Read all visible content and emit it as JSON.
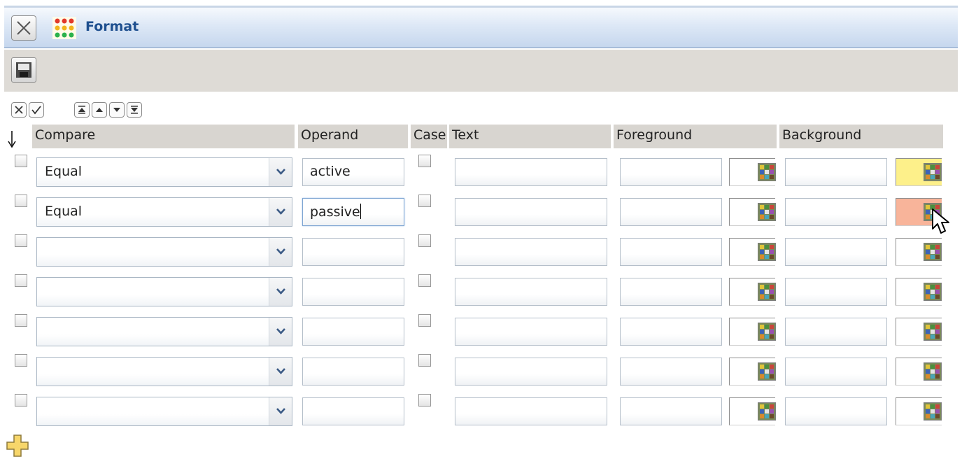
{
  "window": {
    "title": "Format"
  },
  "headers": {
    "compare": "Compare",
    "operand": "Operand",
    "case": "Case",
    "text": "Text",
    "foreground": "Foreground",
    "background": "Background"
  },
  "colors": {
    "row1_background_swatch": "#fdf08a",
    "row2_background_swatch": "#f8b49a",
    "title_text": "#1e4f8f"
  },
  "rows": [
    {
      "compare": "Equal",
      "operand": "active"
    },
    {
      "compare": "Equal",
      "operand": "passive"
    },
    {
      "compare": "",
      "operand": ""
    },
    {
      "compare": "",
      "operand": ""
    },
    {
      "compare": "",
      "operand": ""
    },
    {
      "compare": "",
      "operand": ""
    },
    {
      "compare": "",
      "operand": ""
    }
  ],
  "icons": {
    "close": "close-icon",
    "format": "format-icon",
    "save": "save-icon",
    "deselect_all": "deselect-all-icon",
    "select_all": "select-all-icon",
    "move_top": "move-top-icon",
    "move_up": "move-up-icon",
    "move_down": "move-down-icon",
    "move_bottom": "move-bottom-icon",
    "add_row": "add-row-icon",
    "color_picker": "color-picker-icon"
  }
}
